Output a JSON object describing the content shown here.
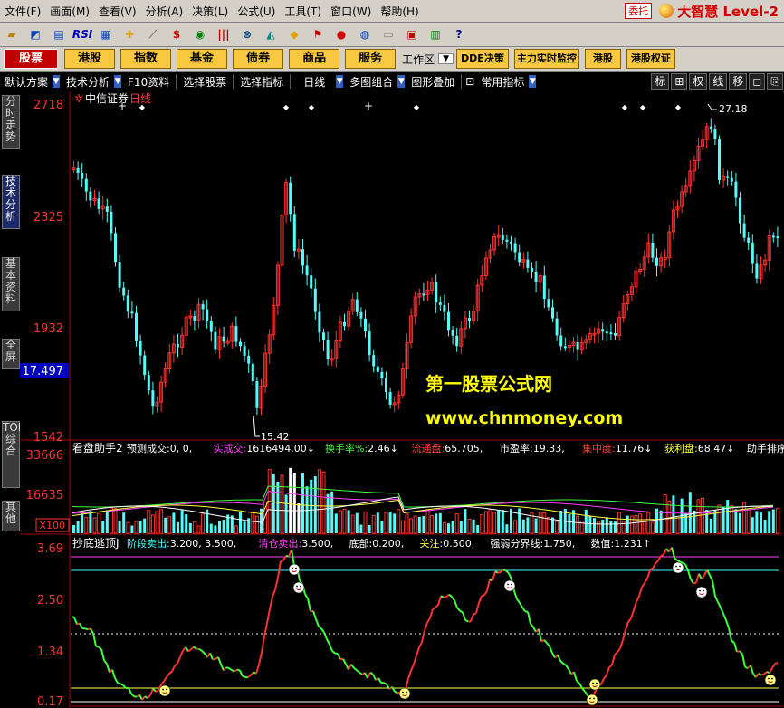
{
  "menu": {
    "items": [
      "文件(F)",
      "画面(M)",
      "查看(V)",
      "分析(A)",
      "决策(L)",
      "公式(U)",
      "工具(T)",
      "窗口(W)",
      "帮助(H)"
    ]
  },
  "brand": {
    "trust_label": "委托",
    "name": "大智慧 Level-2"
  },
  "toolbar": {
    "rsi_label": "RSI"
  },
  "tabs": {
    "red": "股票",
    "yellow": [
      "港股",
      "指数",
      "基金",
      "债券",
      "商品",
      "服务"
    ],
    "workarea": "工作区",
    "right": [
      "DDE决策",
      "主力实时监控",
      "港股",
      "港股权证"
    ]
  },
  "options": {
    "items": [
      "默认方案",
      "技术分析",
      "F10资料",
      "选择股票",
      "选择指标",
      "日线",
      "多图组合",
      "图形叠加",
      "常用指标"
    ],
    "right_buttons": [
      "标",
      "⊞",
      "权",
      "线",
      "移",
      "◻",
      "⎘"
    ]
  },
  "sidebar": {
    "tabs": [
      "分时走势",
      "技术分析",
      "基本资料",
      "全屏",
      "TOP综合",
      "其他"
    ]
  },
  "main_panel": {
    "stock_name": "中信证券",
    "period": "日线",
    "price_labels": [
      "2718",
      "2325",
      "1932",
      "1542"
    ],
    "current_price": "17.497",
    "high_label": "27.18",
    "low_label": "15.42",
    "watermark_1": "第一股票公式网",
    "watermark_2": "www.chnmoney.com"
  },
  "volume_panel": {
    "title": "看盘助手2",
    "fields": [
      {
        "label": "预测成交:",
        "value": "0, 0,",
        "color": "#ffffff"
      },
      {
        "label": "实成交:",
        "value": "1616494.00↓",
        "color": "#ff40ff"
      },
      {
        "label": "换手率%:",
        "value": "2.46↓",
        "color": "#40ff40"
      },
      {
        "label": "流通盘:",
        "value": "65.705,",
        "color": "#ff4040"
      },
      {
        "label": "市盈率:",
        "value": "19.33,",
        "color": "#ffffff"
      },
      {
        "label": "集中度:",
        "value": "11.76↓",
        "color": "#ff4040"
      },
      {
        "label": "获利盘:",
        "value": "68.47↓",
        "color": "#ffff40"
      },
      {
        "label": "助手排序",
        "value": "",
        "color": "#ffffff"
      }
    ],
    "axis_labels": [
      "33666",
      "16635"
    ],
    "unit_label": "X100"
  },
  "indicator_panel": {
    "title": "抄底逃顶J",
    "fields": [
      {
        "label": "阶段卖出:",
        "value": "3.200, 3.500,",
        "color": "#40ffff"
      },
      {
        "label": "清仓卖出:",
        "value": "3.500,",
        "color": "#ff40ff"
      },
      {
        "label": "底部:",
        "value": "0.200,",
        "color": "#ffffff"
      },
      {
        "label": "关注:",
        "value": "0.500,",
        "color": "#ffff40"
      },
      {
        "label": "强弱分界线:",
        "value": "1.750,",
        "color": "#ffffff"
      },
      {
        "label": "数值:",
        "value": "1.231↑",
        "color": "#ffffff"
      }
    ],
    "axis_labels": [
      "3.69",
      "2.50",
      "1.34",
      "0.17"
    ]
  },
  "colors": {
    "up": "#ff3232",
    "down": "#54fcfc",
    "grid": "#800000",
    "magenta": "#ff40ff",
    "cyan": "#40ffff",
    "yellow": "#ffff40",
    "green": "#40ff40"
  }
}
